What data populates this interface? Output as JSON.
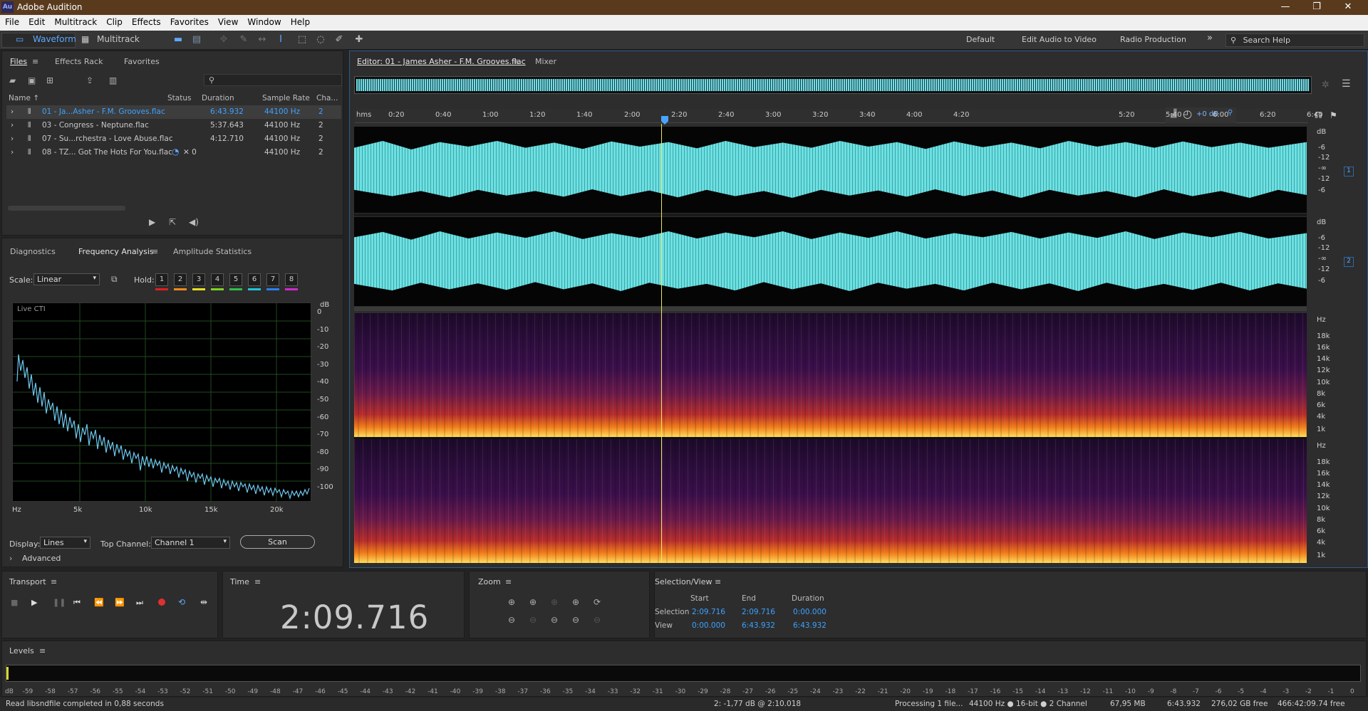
{
  "window": {
    "app_icon": "Au",
    "title": "Adobe Audition",
    "controls": [
      "—",
      "❐",
      "✕"
    ]
  },
  "menu": [
    "File",
    "Edit",
    "Multitrack",
    "Clip",
    "Effects",
    "Favorites",
    "View",
    "Window",
    "Help"
  ],
  "toolbar": {
    "waveform_label": "Waveform",
    "multitrack_label": "Multitrack",
    "workspaces": [
      "Default",
      "Edit Audio to Video",
      "Radio Production"
    ],
    "more": "»",
    "search_placeholder": "Search Help"
  },
  "files_panel": {
    "tabs": [
      "Files",
      "Effects Rack",
      "Favorites"
    ],
    "columns": [
      "Name ↑",
      "Status",
      "Duration",
      "Sample Rate",
      "Cha..."
    ],
    "rows": [
      {
        "name": "01 - Ja...Asher - F.M. Grooves.flac",
        "status": "",
        "duration": "6:43.932",
        "rate": "44100 Hz",
        "ch": "2"
      },
      {
        "name": "03 - Congress - Neptune.flac",
        "status": "",
        "duration": "5:37.643",
        "rate": "44100 Hz",
        "ch": "2"
      },
      {
        "name": "07 - Su...rchestra - Love Abuse.flac",
        "status": "",
        "duration": "4:12.710",
        "rate": "44100 Hz",
        "ch": "2"
      },
      {
        "name": "08 - TZ... Got The Hots For You.flac",
        "status": "✕  0",
        "duration": "",
        "rate": "44100 Hz",
        "ch": "2"
      }
    ]
  },
  "analysis_panel": {
    "tabs": [
      "Diagnostics",
      "Frequency Analysis",
      "Amplitude Statistics"
    ],
    "scale_label": "Scale:",
    "scale_value": "Linear",
    "hold_label": "Hold:",
    "hold_buttons": [
      "1",
      "2",
      "3",
      "4",
      "5",
      "6",
      "7",
      "8"
    ],
    "hold_colors": [
      "#e02020",
      "#f08a1a",
      "#e8e020",
      "#7ed321",
      "#2ec04a",
      "#22c4d6",
      "#2a7ff0",
      "#d02ad0"
    ],
    "live_label": "Live CTI",
    "db_ticks": [
      "dB",
      "0",
      "-10",
      "-20",
      "-30",
      "-40",
      "-50",
      "-60",
      "-70",
      "-80",
      "-90",
      "-100"
    ],
    "hz_ticks": [
      "Hz",
      "5k",
      "10k",
      "15k",
      "20k"
    ],
    "display_label": "Display:",
    "display_value": "Lines",
    "top_channel_label": "Top Channel:",
    "top_channel_value": "Channel 1",
    "scan_label": "Scan",
    "advanced_label": "Advanced"
  },
  "editor": {
    "tab_label": "Editor: 01 - James Asher - F.M. Grooves.flac",
    "mixer_label": "Mixer",
    "ruler": [
      "hms",
      "0:20",
      "0:40",
      "1:00",
      "1:20",
      "1:40",
      "2:00",
      "2:20",
      "2:40",
      "3:00",
      "3:20",
      "3:40",
      "4:00",
      "4:20",
      "5:20",
      "5:40",
      "6:00",
      "6:20",
      "6:40"
    ],
    "gain_label": "+0 dB",
    "wave_db": [
      "dB",
      "-6",
      "-12",
      "-∞",
      "-12",
      "-6"
    ],
    "channel_badges": [
      "1",
      "2"
    ],
    "hz_scale": [
      "Hz",
      "18k",
      "16k",
      "14k",
      "12k",
      "10k",
      "8k",
      "6k",
      "4k",
      "1k"
    ]
  },
  "transport": {
    "title": "Transport"
  },
  "time": {
    "title": "Time",
    "value": "2:09.716"
  },
  "zoom": {
    "title": "Zoom"
  },
  "selection": {
    "title": "Selection/View",
    "headers": [
      "Start",
      "End",
      "Duration"
    ],
    "selection_label": "Selection",
    "view_label": "View",
    "selection": [
      "2:09.716",
      "2:09.716",
      "0:00.000"
    ],
    "view": [
      "0:00.000",
      "6:43.932",
      "6:43.932"
    ]
  },
  "levels": {
    "title": "Levels",
    "ticks": [
      "dB",
      "-59",
      "-58",
      "-57",
      "-56",
      "-55",
      "-54",
      "-53",
      "-52",
      "-51",
      "-50",
      "-49",
      "-48",
      "-47",
      "-46",
      "-45",
      "-44",
      "-43",
      "-42",
      "-41",
      "-40",
      "-39",
      "-38",
      "-37",
      "-36",
      "-35",
      "-34",
      "-33",
      "-32",
      "-31",
      "-30",
      "-29",
      "-28",
      "-27",
      "-26",
      "-25",
      "-24",
      "-23",
      "-22",
      "-21",
      "-20",
      "-19",
      "-18",
      "-17",
      "-16",
      "-15",
      "-14",
      "-13",
      "-12",
      "-11",
      "-10",
      "-9",
      "-8",
      "-7",
      "-6",
      "-5",
      "-4",
      "-3",
      "-2",
      "-1",
      "0"
    ]
  },
  "status": {
    "left": "Read libsndfile completed in 0,88 seconds",
    "cursor": "2: -1,77 dB @ 2:10.018",
    "processing": "Processing 1 file...",
    "format": "44100 Hz ● 16-bit ● 2 Channel",
    "size": "67,95 MB",
    "duration": "6:43.932",
    "free": "276,02 GB free",
    "free_time": "466:42:09.74 free"
  }
}
